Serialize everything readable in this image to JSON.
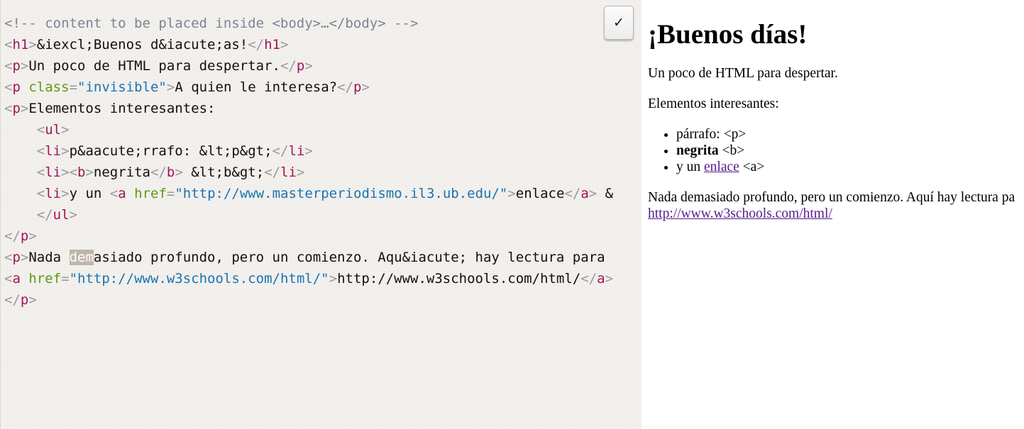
{
  "editor": {
    "run_button_icon": "check-icon",
    "run_button_glyph": "✓",
    "lines": [
      [
        {
          "t": "<!-- content to be placed inside <body>…</body> -->",
          "c": "cmt"
        }
      ],
      [
        {
          "t": "<",
          "c": "br"
        },
        {
          "t": "h1",
          "c": "tag"
        },
        {
          "t": ">",
          "c": "br"
        },
        {
          "t": "&iexcl;Buenos d&iacute;as!",
          "c": "txt"
        },
        {
          "t": "</",
          "c": "br"
        },
        {
          "t": "h1",
          "c": "tag"
        },
        {
          "t": ">",
          "c": "br"
        }
      ],
      [
        {
          "t": "<",
          "c": "br"
        },
        {
          "t": "p",
          "c": "tag"
        },
        {
          "t": ">",
          "c": "br"
        },
        {
          "t": "Un poco de HTML para despertar.",
          "c": "txt"
        },
        {
          "t": "</",
          "c": "br"
        },
        {
          "t": "p",
          "c": "tag"
        },
        {
          "t": ">",
          "c": "br"
        }
      ],
      [
        {
          "t": "<",
          "c": "br"
        },
        {
          "t": "p",
          "c": "tag"
        },
        {
          "t": " ",
          "c": "txt"
        },
        {
          "t": "class",
          "c": "att"
        },
        {
          "t": "=",
          "c": "br"
        },
        {
          "t": "\"invisible\"",
          "c": "str"
        },
        {
          "t": ">",
          "c": "br"
        },
        {
          "t": "A quien le interesa?",
          "c": "txt"
        },
        {
          "t": "</",
          "c": "br"
        },
        {
          "t": "p",
          "c": "tag"
        },
        {
          "t": ">",
          "c": "br"
        }
      ],
      [
        {
          "t": "<",
          "c": "br"
        },
        {
          "t": "p",
          "c": "tag"
        },
        {
          "t": ">",
          "c": "br"
        },
        {
          "t": "Elementos interesantes:",
          "c": "txt"
        }
      ],
      [
        {
          "t": "    ",
          "c": "txt"
        },
        {
          "t": "<",
          "c": "br"
        },
        {
          "t": "ul",
          "c": "tag"
        },
        {
          "t": ">",
          "c": "br"
        }
      ],
      [
        {
          "t": "    ",
          "c": "txt"
        },
        {
          "t": "<",
          "c": "br"
        },
        {
          "t": "li",
          "c": "tag"
        },
        {
          "t": ">",
          "c": "br"
        },
        {
          "t": "p&aacute;rrafo: &lt;p&gt;",
          "c": "txt"
        },
        {
          "t": "</",
          "c": "br"
        },
        {
          "t": "li",
          "c": "tag"
        },
        {
          "t": ">",
          "c": "br"
        }
      ],
      [
        {
          "t": "    ",
          "c": "txt"
        },
        {
          "t": "<",
          "c": "br"
        },
        {
          "t": "li",
          "c": "tag"
        },
        {
          "t": ">",
          "c": "br"
        },
        {
          "t": "<",
          "c": "br"
        },
        {
          "t": "b",
          "c": "tag"
        },
        {
          "t": ">",
          "c": "br"
        },
        {
          "t": "negrita",
          "c": "txt"
        },
        {
          "t": "</",
          "c": "br"
        },
        {
          "t": "b",
          "c": "tag"
        },
        {
          "t": ">",
          "c": "br"
        },
        {
          "t": " &lt;b&gt;",
          "c": "txt"
        },
        {
          "t": "</",
          "c": "br"
        },
        {
          "t": "li",
          "c": "tag"
        },
        {
          "t": ">",
          "c": "br"
        }
      ],
      [
        {
          "t": "    ",
          "c": "txt"
        },
        {
          "t": "<",
          "c": "br"
        },
        {
          "t": "li",
          "c": "tag"
        },
        {
          "t": ">",
          "c": "br"
        },
        {
          "t": "y un ",
          "c": "txt"
        },
        {
          "t": "<",
          "c": "br"
        },
        {
          "t": "a",
          "c": "tag"
        },
        {
          "t": " ",
          "c": "txt"
        },
        {
          "t": "href",
          "c": "att"
        },
        {
          "t": "=",
          "c": "br"
        },
        {
          "t": "\"http://www.masterperiodismo.il3.ub.edu/\"",
          "c": "str"
        },
        {
          "t": ">",
          "c": "br"
        },
        {
          "t": "enlace",
          "c": "txt"
        },
        {
          "t": "</",
          "c": "br"
        },
        {
          "t": "a",
          "c": "tag"
        },
        {
          "t": ">",
          "c": "br"
        },
        {
          "t": " &",
          "c": "txt"
        }
      ],
      [
        {
          "t": "    ",
          "c": "txt"
        },
        {
          "t": "</",
          "c": "br"
        },
        {
          "t": "ul",
          "c": "tag"
        },
        {
          "t": ">",
          "c": "br"
        }
      ],
      [
        {
          "t": "</",
          "c": "br"
        },
        {
          "t": "p",
          "c": "tag"
        },
        {
          "t": ">",
          "c": "br"
        }
      ],
      [
        {
          "t": "<",
          "c": "br"
        },
        {
          "t": "p",
          "c": "tag"
        },
        {
          "t": ">",
          "c": "br"
        },
        {
          "t": "Nada ",
          "c": "txt"
        },
        {
          "t": "dem",
          "c": "hl"
        },
        {
          "t": "asiado profundo, pero un comienzo. Aqu&iacute; hay lectura para",
          "c": "txt"
        }
      ],
      [
        {
          "t": "<",
          "c": "br"
        },
        {
          "t": "a",
          "c": "tag"
        },
        {
          "t": " ",
          "c": "txt"
        },
        {
          "t": "href",
          "c": "att"
        },
        {
          "t": "=",
          "c": "br"
        },
        {
          "t": "\"http://www.w3schools.com/html/\"",
          "c": "str"
        },
        {
          "t": ">",
          "c": "br"
        },
        {
          "t": "http://www.w3schools.com/html/",
          "c": "txt"
        },
        {
          "t": "</",
          "c": "br"
        },
        {
          "t": "a",
          "c": "tag"
        },
        {
          "t": ">",
          "c": "br"
        }
      ],
      [
        {
          "t": "</",
          "c": "br"
        },
        {
          "t": "p",
          "c": "tag"
        },
        {
          "t": ">",
          "c": "br"
        }
      ]
    ]
  },
  "preview": {
    "heading": "¡Buenos días!",
    "para1": "Un poco de HTML para despertar.",
    "para2": "Elementos interesantes:",
    "li1": "párrafo: <p>",
    "li2_bold": "negrita",
    "li2_rest": " <b>",
    "li3_prefix": "y un ",
    "li3_link": "enlace",
    "li3_suffix": " <a>",
    "para3": "Nada demasiado profundo, pero un comienzo. Aquí hay lectura pa",
    "para3_link": "http://www.w3schools.com/html/",
    "link_color": "#551a8b"
  },
  "colors": {
    "comment": "#7a8594",
    "tag": "#a0145a",
    "attribute": "#5e9a17",
    "string": "#1a74b3",
    "bracket": "#9a9a9a",
    "selection": "#c0b5aa"
  }
}
